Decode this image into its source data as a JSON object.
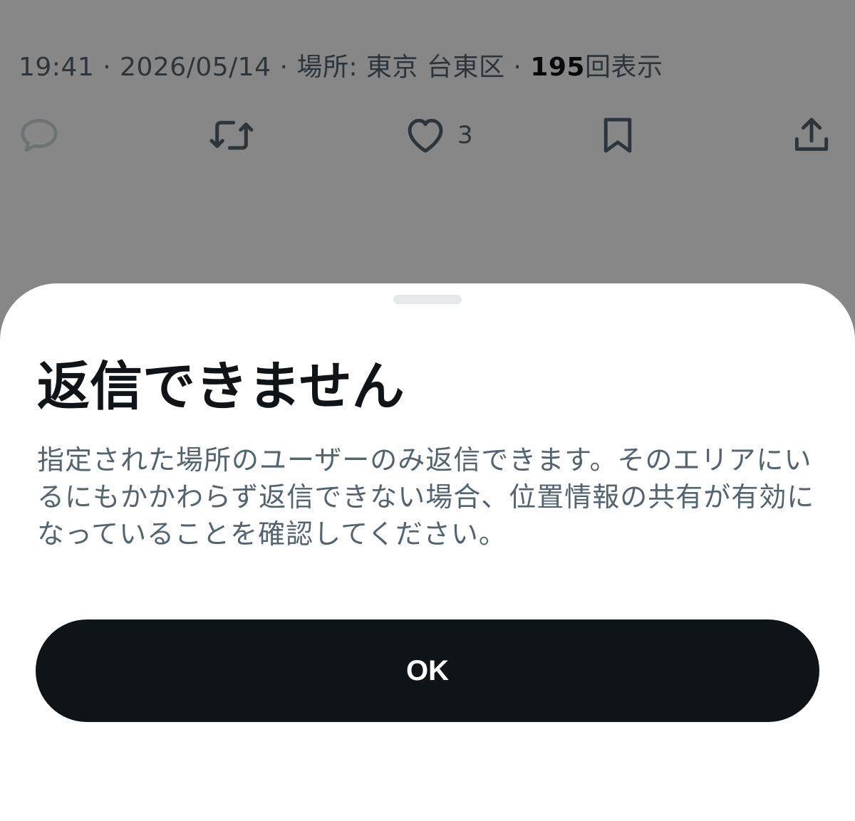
{
  "tweet_meta": {
    "time": "19:41",
    "date": "2026/05/14",
    "location_label": "場所: 東京 台東区",
    "view_count": "195",
    "view_suffix": "回表示"
  },
  "actions": {
    "reply_icon": "reply-icon",
    "retweet_icon": "retweet-icon",
    "like_icon": "heart-icon",
    "like_count": "3",
    "bookmark_icon": "bookmark-icon",
    "share_icon": "share-icon"
  },
  "dialog": {
    "title": "返信できません",
    "body": "指定された場所のユーザーのみ返信できます。そのエリアにいるにもかかわらず返信できない場合、位置情報の共有が有効になっていることを確認してください。",
    "ok_label": "OK"
  },
  "colors": {
    "scrim": "#000000",
    "secondary_text": "#536471",
    "primary_text": "#0f1419",
    "button_bg": "#0f1419",
    "button_text": "#ffffff"
  }
}
